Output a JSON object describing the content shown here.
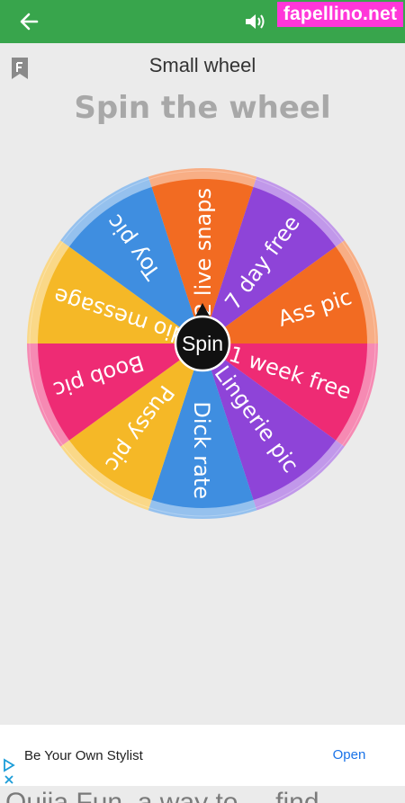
{
  "app_bar": {
    "back_icon": "arrow-left-icon",
    "volume_icon": "volume-icon",
    "watermark": "fapellino.net",
    "color": "#38a54c"
  },
  "header": {
    "wheel_name": "Small wheel",
    "title": "Spin the wheel",
    "flag_icon": "flag-icon"
  },
  "wheel": {
    "center_label": "Spin",
    "segments": [
      {
        "label": "2 live snaps",
        "color": "#f26b22"
      },
      {
        "label": "7 day free",
        "color": "#8e44d8"
      },
      {
        "label": "Ass pic",
        "color": "#f26b22"
      },
      {
        "label": "1 week free",
        "color": "#ee2b74"
      },
      {
        "label": "Lingerie pic",
        "color": "#8e44d8"
      },
      {
        "label": "Dick rate",
        "color": "#3f8ee0"
      },
      {
        "label": "Pussy pic",
        "color": "#f5b827"
      },
      {
        "label": "Boob pic",
        "color": "#ee2b74"
      },
      {
        "label": "Audio message",
        "color": "#f5b827"
      },
      {
        "label": "Toy pic",
        "color": "#3f8ee0"
      }
    ]
  },
  "ad": {
    "text": "Be Your Own Stylist",
    "button": "Open",
    "icon": "adchoices-icon"
  },
  "bottom_text": "Ouija Fun, a way to ... find"
}
